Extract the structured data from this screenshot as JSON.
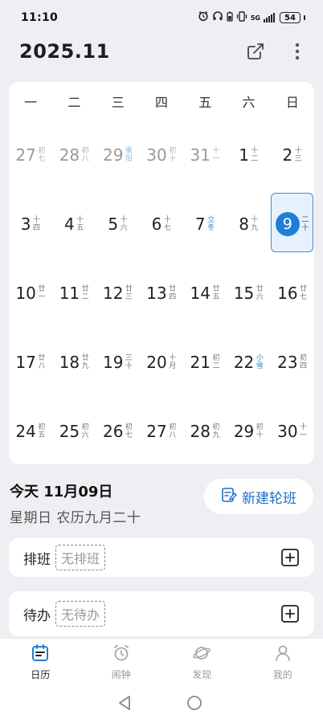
{
  "status": {
    "time": "11:10",
    "battery": "54",
    "network": "5G"
  },
  "header": {
    "title": "2025.11"
  },
  "calendar": {
    "weekdays": [
      "一",
      "二",
      "三",
      "四",
      "五",
      "六",
      "日"
    ],
    "weeks": [
      [
        {
          "day": "27",
          "lunar": "初七",
          "other": true
        },
        {
          "day": "28",
          "lunar": "初八",
          "other": true
        },
        {
          "day": "29",
          "lunar": "重阳",
          "other": true,
          "term": true
        },
        {
          "day": "30",
          "lunar": "初十",
          "other": true
        },
        {
          "day": "31",
          "lunar": "十一",
          "other": true
        },
        {
          "day": "1",
          "lunar": "十二"
        },
        {
          "day": "2",
          "lunar": "十三"
        }
      ],
      [
        {
          "day": "3",
          "lunar": "十四"
        },
        {
          "day": "4",
          "lunar": "十五"
        },
        {
          "day": "5",
          "lunar": "十六"
        },
        {
          "day": "6",
          "lunar": "十七"
        },
        {
          "day": "7",
          "lunar": "立冬",
          "term": true
        },
        {
          "day": "8",
          "lunar": "十九"
        },
        {
          "day": "9",
          "lunar": "二十",
          "today": true
        }
      ],
      [
        {
          "day": "10",
          "lunar": "廿一"
        },
        {
          "day": "11",
          "lunar": "廿二"
        },
        {
          "day": "12",
          "lunar": "廿三"
        },
        {
          "day": "13",
          "lunar": "廿四"
        },
        {
          "day": "14",
          "lunar": "廿五"
        },
        {
          "day": "15",
          "lunar": "廿六"
        },
        {
          "day": "16",
          "lunar": "廿七"
        }
      ],
      [
        {
          "day": "17",
          "lunar": "廿八"
        },
        {
          "day": "18",
          "lunar": "廿九"
        },
        {
          "day": "19",
          "lunar": "三十"
        },
        {
          "day": "20",
          "lunar": "十月"
        },
        {
          "day": "21",
          "lunar": "初二"
        },
        {
          "day": "22",
          "lunar": "小雪",
          "term": true
        },
        {
          "day": "23",
          "lunar": "初四"
        }
      ],
      [
        {
          "day": "24",
          "lunar": "初五"
        },
        {
          "day": "25",
          "lunar": "初六"
        },
        {
          "day": "26",
          "lunar": "初七"
        },
        {
          "day": "27",
          "lunar": "初八"
        },
        {
          "day": "28",
          "lunar": "初九"
        },
        {
          "day": "29",
          "lunar": "初十"
        },
        {
          "day": "30",
          "lunar": "十一"
        }
      ]
    ]
  },
  "today": {
    "title": "今天 11月09日",
    "subtitle": "星期日 农历九月二十",
    "new_shift_label": "新建轮班"
  },
  "rows": {
    "shift": {
      "label": "排班",
      "tag": "无排班"
    },
    "todo": {
      "label": "待办",
      "tag": "无待办"
    }
  },
  "nav": {
    "items": [
      {
        "label": "日历",
        "icon": "calendar-icon",
        "active": true
      },
      {
        "label": "闹钟",
        "icon": "alarm-icon"
      },
      {
        "label": "发现",
        "icon": "planet-icon"
      },
      {
        "label": "我的",
        "icon": "profile-icon"
      }
    ]
  },
  "colors": {
    "accent": "#1f7fd6",
    "term": "#2b8bd1",
    "background": "#efeff3"
  }
}
